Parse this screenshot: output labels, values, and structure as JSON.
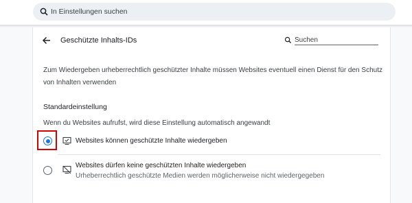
{
  "top_search": {
    "placeholder": "In Einstellungen suchen"
  },
  "header": {
    "title": "Geschützte Inhalts-IDs",
    "search_placeholder": "Suchen"
  },
  "description": "Zum Wiedergeben urheberrechtlich geschützter Inhalte müssen Websites eventuell einen Dienst für den Schutz von Inhalten verwenden",
  "default_section": {
    "title": "Standardeinstellung",
    "hint": "Wenn du Websites aufrufst, wird diese Einstellung automatisch angewandt",
    "options": [
      {
        "label": "Websites können geschützte Inhalte wiedergeben",
        "selected": true,
        "icon": "protected-content-allowed-icon"
      },
      {
        "label": "Websites dürfen keine geschützten Inhalte wiedergeben",
        "sublabel": "Urheberrechtlich geschützte Medien werden möglicherweise nicht wiedergegeben",
        "selected": false,
        "icon": "protected-content-blocked-icon"
      }
    ]
  },
  "colors": {
    "accent": "#1a73e8",
    "highlight": "#d50000"
  }
}
